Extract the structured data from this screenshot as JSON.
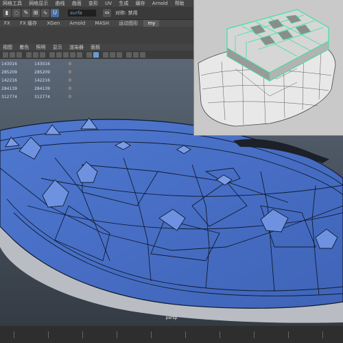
{
  "menubar": {
    "items": [
      "网格工具",
      "网格显示",
      "曲线",
      "曲面",
      "变形",
      "UV",
      "生成",
      "缓存",
      "Arnold",
      "帮助"
    ]
  },
  "statusline": {
    "object_field": "surfa",
    "symmetry_label": "对称: 禁用"
  },
  "shelf": {
    "tabs": [
      "FX",
      "FX 缓存",
      "XGen",
      "Arnold",
      "MASH",
      "运动图形",
      "my"
    ],
    "active_tab": "my"
  },
  "panel": {
    "menu": [
      "视图",
      "着色",
      "照明",
      "显示",
      "渲染器",
      "面板"
    ]
  },
  "hud": {
    "rows": [
      [
        "143016",
        "143016",
        "0"
      ],
      [
        "285209",
        "285209",
        "0"
      ],
      [
        "142216",
        "142216",
        "0"
      ],
      [
        "284139",
        "284139",
        "0"
      ],
      [
        "312774",
        "312774",
        "0"
      ]
    ]
  },
  "viewport": {
    "camera_label": "persp"
  },
  "colors": {
    "mesh_blue": "#4a70c8",
    "wire": "#0f1a2e",
    "inset_bg": "#c9c9c9",
    "selection_green": "#3fe0a0"
  },
  "icons": [
    "select-icon",
    "lasso-icon",
    "paint-select-icon",
    "snap-grid-icon",
    "snap-curve-icon",
    "snap-point-icon",
    "magnet-icon",
    "symmetry-icon"
  ]
}
